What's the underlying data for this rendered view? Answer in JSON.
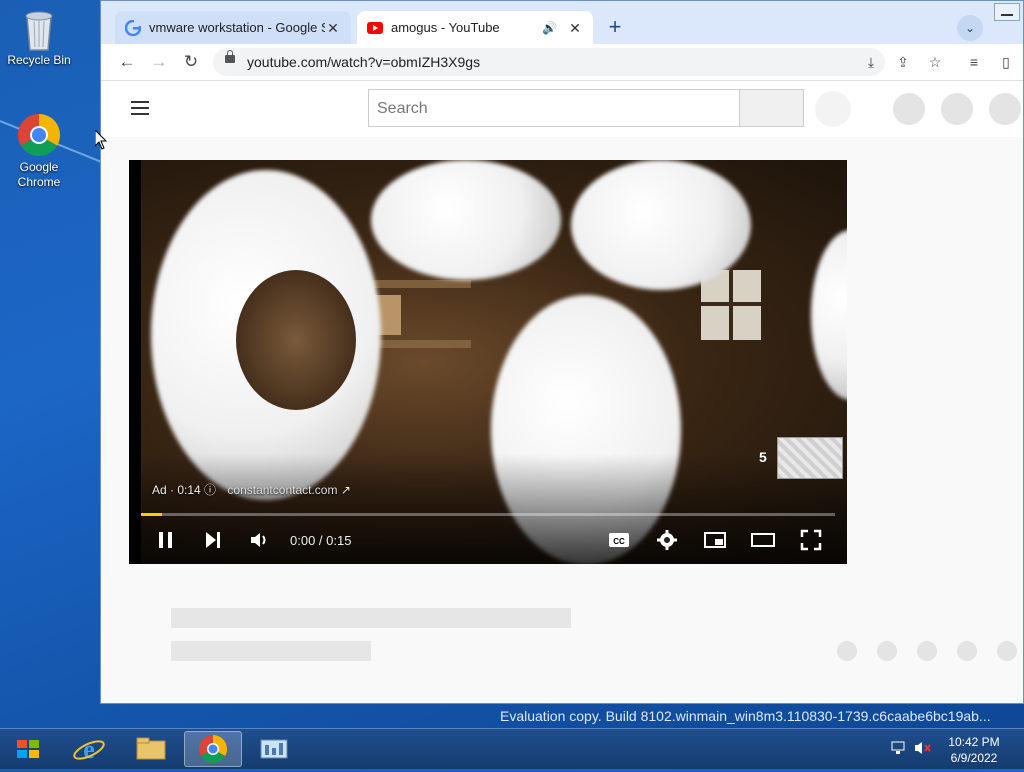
{
  "desktop": {
    "icons": [
      {
        "label": "Recycle Bin",
        "icon": "recycle-bin-icon"
      },
      {
        "label": "Google Chrome",
        "icon": "chrome-icon"
      }
    ],
    "watermark": "Evaluation copy. Build 8102.winmain_win8m3.110830-1739.c6caabe6bc19ab..."
  },
  "browser": {
    "tabs": [
      {
        "title": "vmware workstation - Google Se",
        "favicon": "google-g-icon",
        "active": false
      },
      {
        "title": "amogus - YouTube",
        "favicon": "youtube-icon",
        "active": true,
        "audio": true
      }
    ],
    "url": "youtube.com/watch?v=obmIZH3X9gs",
    "toolbar_icons": [
      "back-icon",
      "forward-icon",
      "reload-icon",
      "lock-icon",
      "install-icon",
      "share-icon",
      "bookmark-star-icon",
      "reading-list-icon",
      "side-panel-icon"
    ]
  },
  "youtube": {
    "search_placeholder": "Search",
    "player": {
      "ad_label": "Ad · 0:14",
      "ad_site": "constantcontact.com",
      "skip_countdown": "5",
      "time": "0:00 / 0:15",
      "progress_fraction": 0.03,
      "accent": "#ffcc00"
    }
  },
  "taskbar": {
    "apps": [
      "start-icon",
      "internet-explorer-icon",
      "file-explorer-icon",
      "chrome-icon",
      "control-panel-icon"
    ],
    "time": "10:42 PM",
    "date": "6/9/2022"
  }
}
